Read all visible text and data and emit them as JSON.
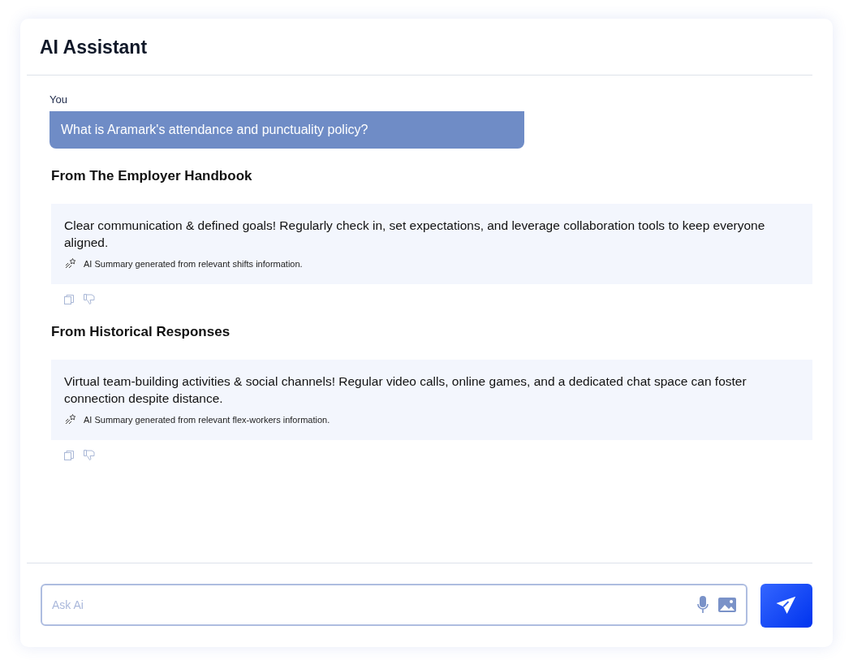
{
  "header": {
    "title": "AI Assistant"
  },
  "question": {
    "sender": "You",
    "text": "What is Aramark's attendance and punctuality policy?"
  },
  "answers": [
    {
      "heading": "From The Employer Handbook",
      "text": "Clear communication & defined goals! Regularly check in, set expectations, and leverage collaboration tools to keep everyone aligned.",
      "note": "AI Summary generated from relevant shifts information."
    },
    {
      "heading": "From Historical Responses",
      "text": "Virtual team-building activities & social channels! Regular video calls, online games, and a dedicated chat space can foster connection despite distance.",
      "note": "AI Summary generated from relevant flex-workers information."
    }
  ],
  "composer": {
    "placeholder": "Ask Ai"
  }
}
